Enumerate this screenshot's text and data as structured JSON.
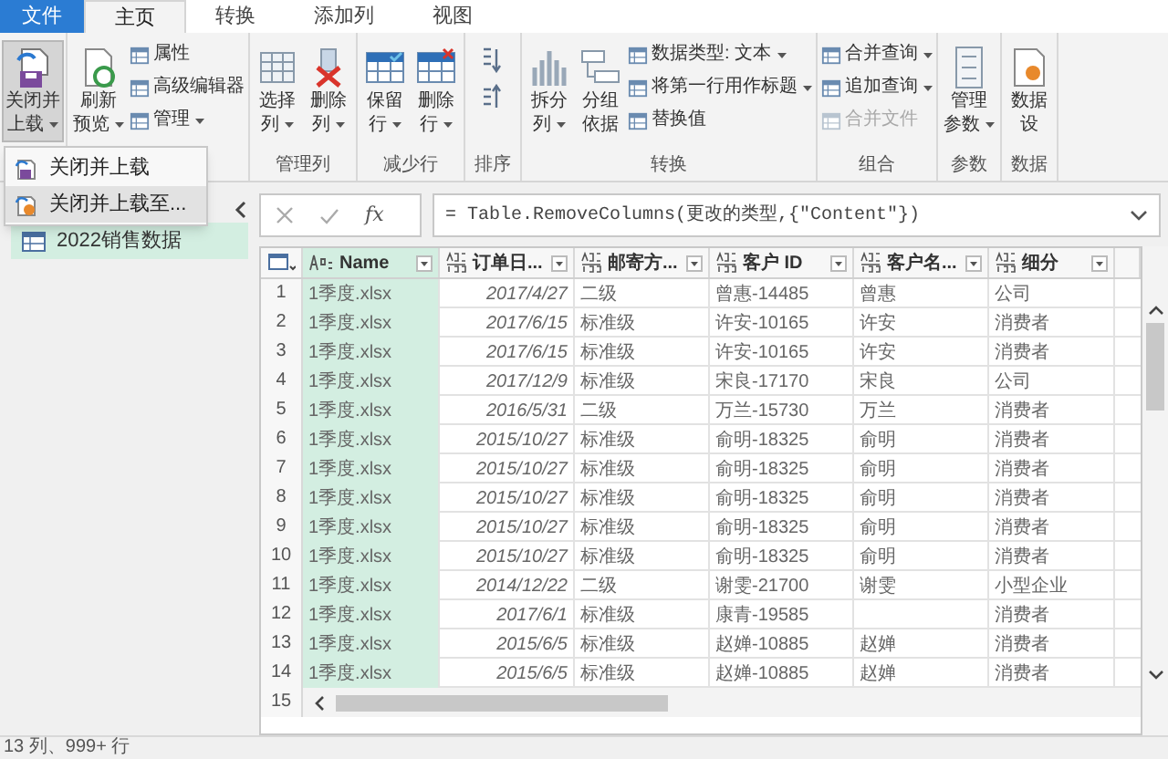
{
  "tabs": [
    {
      "label": "文件",
      "kind": "file",
      "selected": false
    },
    {
      "label": "主页",
      "kind": "tab",
      "selected": true
    },
    {
      "label": "转换",
      "kind": "tab",
      "selected": false
    },
    {
      "label": "添加列",
      "kind": "tab",
      "selected": false
    },
    {
      "label": "视图",
      "kind": "tab",
      "selected": false
    }
  ],
  "ribbon": {
    "groups": [
      {
        "items": [
          {
            "kind": "large",
            "lines": [
              "关闭并",
              "上载"
            ],
            "dropdown": true,
            "pressed": true
          }
        ]
      },
      {
        "items": [
          {
            "kind": "large",
            "lines": [
              "刷新",
              "预览"
            ],
            "dropdown": true,
            "pressed": false
          },
          {
            "kind": "stack",
            "entries": [
              {
                "label": "属性",
                "dropdown": false,
                "disabled": false
              },
              {
                "label": "高级编辑器",
                "dropdown": false,
                "disabled": false
              },
              {
                "label": "管理",
                "dropdown": true,
                "disabled": false
              }
            ]
          }
        ]
      },
      {
        "label": "管理列",
        "items": [
          {
            "kind": "large",
            "lines": [
              "选择",
              "列"
            ],
            "dropdown": true,
            "pressed": false
          },
          {
            "kind": "large",
            "lines": [
              "删除",
              "列"
            ],
            "dropdown": true,
            "pressed": false
          }
        ]
      },
      {
        "label": "减少行",
        "items": [
          {
            "kind": "large",
            "lines": [
              "保留",
              "行"
            ],
            "dropdown": true,
            "pressed": false
          },
          {
            "kind": "large",
            "lines": [
              "删除",
              "行"
            ],
            "dropdown": true,
            "pressed": false
          }
        ]
      },
      {
        "label": "排序",
        "items": [
          {
            "kind": "sort"
          }
        ]
      },
      {
        "label": "转换",
        "items": [
          {
            "kind": "large",
            "lines": [
              "拆分",
              "列"
            ],
            "dropdown": true,
            "pressed": false
          },
          {
            "kind": "large",
            "lines": [
              "分组",
              "依据"
            ],
            "dropdown": false,
            "pressed": false
          },
          {
            "kind": "stack",
            "entries": [
              {
                "label": "数据类型: 文本",
                "dropdown": true,
                "disabled": false
              },
              {
                "label": "将第一行用作标题",
                "dropdown": true,
                "disabled": false
              },
              {
                "label": "替换值",
                "dropdown": false,
                "disabled": false
              }
            ]
          }
        ]
      },
      {
        "label": "组合",
        "items": [
          {
            "kind": "stack",
            "entries": [
              {
                "label": "合并查询",
                "dropdown": true,
                "disabled": false
              },
              {
                "label": "追加查询",
                "dropdown": true,
                "disabled": false
              },
              {
                "label": "合并文件",
                "dropdown": false,
                "disabled": true
              }
            ]
          }
        ]
      },
      {
        "label": "参数",
        "items": [
          {
            "kind": "large",
            "lines": [
              "管理",
              "参数"
            ],
            "dropdown": true,
            "pressed": false
          }
        ]
      },
      {
        "label": "数据",
        "items": [
          {
            "kind": "large",
            "lines": [
              "数据",
              "设"
            ],
            "dropdown": false,
            "pressed": false
          }
        ]
      }
    ]
  },
  "menu": {
    "items": [
      {
        "label": "关闭并上载",
        "selected": false
      },
      {
        "label": "关闭并上载至...",
        "selected": true
      }
    ]
  },
  "sidebar": {
    "queries": [
      {
        "name": "2022销售数据",
        "selected": true
      }
    ]
  },
  "formula_bar": {
    "fx": "fx",
    "formula": "= Table.RemoveColumns(更改的类型,{\"Content\"})"
  },
  "table": {
    "columns": [
      {
        "name": "Name",
        "kind": "text",
        "selected": true
      },
      {
        "name": "订单日...",
        "kind": "any",
        "selected": false
      },
      {
        "name": "邮寄方...",
        "kind": "any",
        "selected": false
      },
      {
        "name": "客户 ID",
        "kind": "any",
        "selected": false
      },
      {
        "name": "客户名...",
        "kind": "any",
        "selected": false
      },
      {
        "name": "细分",
        "kind": "any",
        "selected": false
      }
    ],
    "rows": [
      {
        "number": "1",
        "cells": [
          "1季度.xlsx",
          "2017/4/27",
          "二级",
          "曾惠-14485",
          "曾惠",
          "公司"
        ]
      },
      {
        "number": "2",
        "cells": [
          "1季度.xlsx",
          "2017/6/15",
          "标准级",
          "许安-10165",
          "许安",
          "消费者"
        ]
      },
      {
        "number": "3",
        "cells": [
          "1季度.xlsx",
          "2017/6/15",
          "标准级",
          "许安-10165",
          "许安",
          "消费者"
        ]
      },
      {
        "number": "4",
        "cells": [
          "1季度.xlsx",
          "2017/12/9",
          "标准级",
          "宋良-17170",
          "宋良",
          "公司"
        ]
      },
      {
        "number": "5",
        "cells": [
          "1季度.xlsx",
          "2016/5/31",
          "二级",
          "万兰-15730",
          "万兰",
          "消费者"
        ]
      },
      {
        "number": "6",
        "cells": [
          "1季度.xlsx",
          "2015/10/27",
          "标准级",
          "俞明-18325",
          "俞明",
          "消费者"
        ]
      },
      {
        "number": "7",
        "cells": [
          "1季度.xlsx",
          "2015/10/27",
          "标准级",
          "俞明-18325",
          "俞明",
          "消费者"
        ]
      },
      {
        "number": "8",
        "cells": [
          "1季度.xlsx",
          "2015/10/27",
          "标准级",
          "俞明-18325",
          "俞明",
          "消费者"
        ]
      },
      {
        "number": "9",
        "cells": [
          "1季度.xlsx",
          "2015/10/27",
          "标准级",
          "俞明-18325",
          "俞明",
          "消费者"
        ]
      },
      {
        "number": "10",
        "cells": [
          "1季度.xlsx",
          "2015/10/27",
          "标准级",
          "俞明-18325",
          "俞明",
          "消费者"
        ]
      },
      {
        "number": "11",
        "cells": [
          "1季度.xlsx",
          "2014/12/22",
          "二级",
          "谢雯-21700",
          "谢雯",
          "小型企业"
        ]
      },
      {
        "number": "12",
        "cells": [
          "1季度.xlsx",
          "2017/6/1",
          "标准级",
          "康青-19585",
          null,
          "消费者"
        ]
      },
      {
        "number": "13",
        "cells": [
          "1季度.xlsx",
          "2015/6/5",
          "标准级",
          "赵婵-10885",
          "赵婵",
          "消费者"
        ]
      },
      {
        "number": "14",
        "cells": [
          "1季度.xlsx",
          "2015/6/5",
          "标准级",
          "赵婵-10885",
          "赵婵",
          "消费者"
        ]
      },
      {
        "number": "15"
      }
    ]
  },
  "status_bar": {
    "text": "13 列、999+ 行"
  }
}
